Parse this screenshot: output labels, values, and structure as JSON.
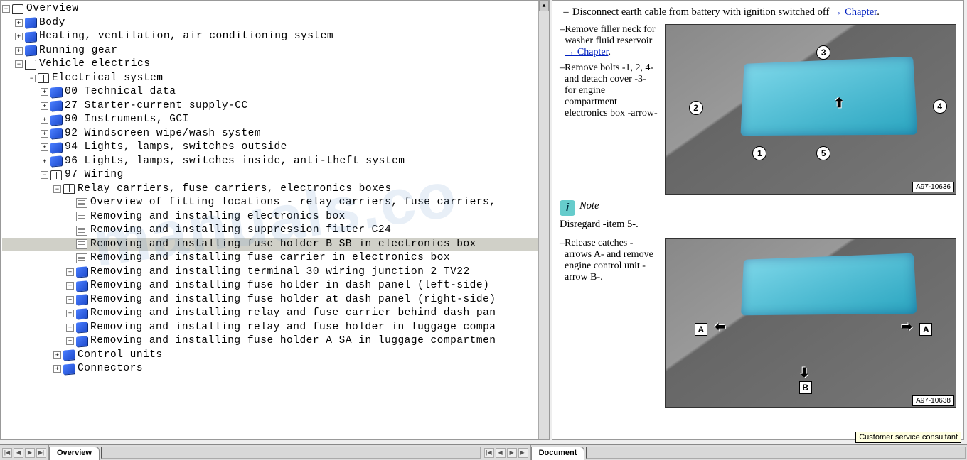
{
  "tree": {
    "root": "Overview",
    "items": [
      {
        "label": "Overview",
        "icon": "book-open",
        "toggle": "minus",
        "indent": 0
      },
      {
        "label": "Body",
        "icon": "book",
        "toggle": "plus",
        "indent": 1
      },
      {
        "label": "Heating, ventilation, air conditioning system",
        "icon": "book",
        "toggle": "plus",
        "indent": 1
      },
      {
        "label": "Running gear",
        "icon": "book",
        "toggle": "plus",
        "indent": 1
      },
      {
        "label": "Vehicle electrics",
        "icon": "book-open",
        "toggle": "minus",
        "indent": 1
      },
      {
        "label": "Electrical system",
        "icon": "book-open",
        "toggle": "minus",
        "indent": 2
      },
      {
        "label": "00 Technical data",
        "icon": "book",
        "toggle": "plus",
        "indent": 3
      },
      {
        "label": "27 Starter-current supply-CC",
        "icon": "book",
        "toggle": "plus",
        "indent": 3
      },
      {
        "label": "90 Instruments, GCI",
        "icon": "book",
        "toggle": "plus",
        "indent": 3
      },
      {
        "label": "92 Windscreen wipe/wash system",
        "icon": "book",
        "toggle": "plus",
        "indent": 3
      },
      {
        "label": "94 Lights, lamps, switches outside",
        "icon": "book",
        "toggle": "plus",
        "indent": 3
      },
      {
        "label": "96 Lights, lamps, switches inside, anti-theft system",
        "icon": "book",
        "toggle": "plus",
        "indent": 3
      },
      {
        "label": "97 Wiring",
        "icon": "book-open",
        "toggle": "minus",
        "indent": 3
      },
      {
        "label": "Relay carriers, fuse carriers, electronics boxes",
        "icon": "book-open",
        "toggle": "minus",
        "indent": 4
      },
      {
        "label": "Overview of fitting locations - relay carriers, fuse carriers,",
        "icon": "page",
        "toggle": "none",
        "indent": 5
      },
      {
        "label": "Removing and installing electronics box",
        "icon": "page",
        "toggle": "none",
        "indent": 5
      },
      {
        "label": "Removing and installing suppression filter C24",
        "icon": "page",
        "toggle": "none",
        "indent": 5
      },
      {
        "label": "Removing and installing fuse holder B SB in electronics box",
        "icon": "page",
        "toggle": "none",
        "indent": 5,
        "selected": true
      },
      {
        "label": "Removing and installing fuse carrier in electronics box",
        "icon": "page",
        "toggle": "none",
        "indent": 5
      },
      {
        "label": "Removing and installing terminal 30 wiring junction 2 TV22",
        "icon": "book",
        "toggle": "plus",
        "indent": 5
      },
      {
        "label": "Removing and installing fuse holder in dash panel (left-side)",
        "icon": "book",
        "toggle": "plus",
        "indent": 5
      },
      {
        "label": "Removing and installing fuse holder at dash panel (right-side)",
        "icon": "book",
        "toggle": "plus",
        "indent": 5
      },
      {
        "label": "Removing and installing relay and fuse carrier behind dash pan",
        "icon": "book",
        "toggle": "plus",
        "indent": 5
      },
      {
        "label": "Removing and installing relay and fuse holder in luggage compa",
        "icon": "book",
        "toggle": "plus",
        "indent": 5
      },
      {
        "label": "Removing and installing fuse holder A SA in luggage compartmen",
        "icon": "book",
        "toggle": "plus",
        "indent": 5
      },
      {
        "label": "Control units",
        "icon": "book",
        "toggle": "plus",
        "indent": 4
      },
      {
        "label": "Connectors",
        "icon": "book",
        "toggle": "plus",
        "indent": 4
      }
    ]
  },
  "document": {
    "step1": "Disconnect earth cable from battery with ignition switched off ",
    "chapter_link": "→ Chapter",
    "caption1_line1": "Remove filler neck for washer fluid reservoir ",
    "caption1_line2": "Remove bolts -1, 2, 4- and detach cover -3- for engine compartment electronics box -arrow-",
    "note_label": "Note",
    "note_text": "Disregard -item 5-.",
    "caption2": "Release catches -arrows A- and remove engine control unit -arrow B-.",
    "fig1_label": "A97-10636",
    "fig2_label": "A97-10638",
    "callouts1": [
      "1",
      "2",
      "3",
      "4",
      "5"
    ],
    "callouts2": [
      "A",
      "A",
      "B"
    ]
  },
  "tabs": {
    "left": "Overview",
    "right": "Document"
  },
  "tooltip": "Customer service consultant",
  "watermark": "manuals.co"
}
